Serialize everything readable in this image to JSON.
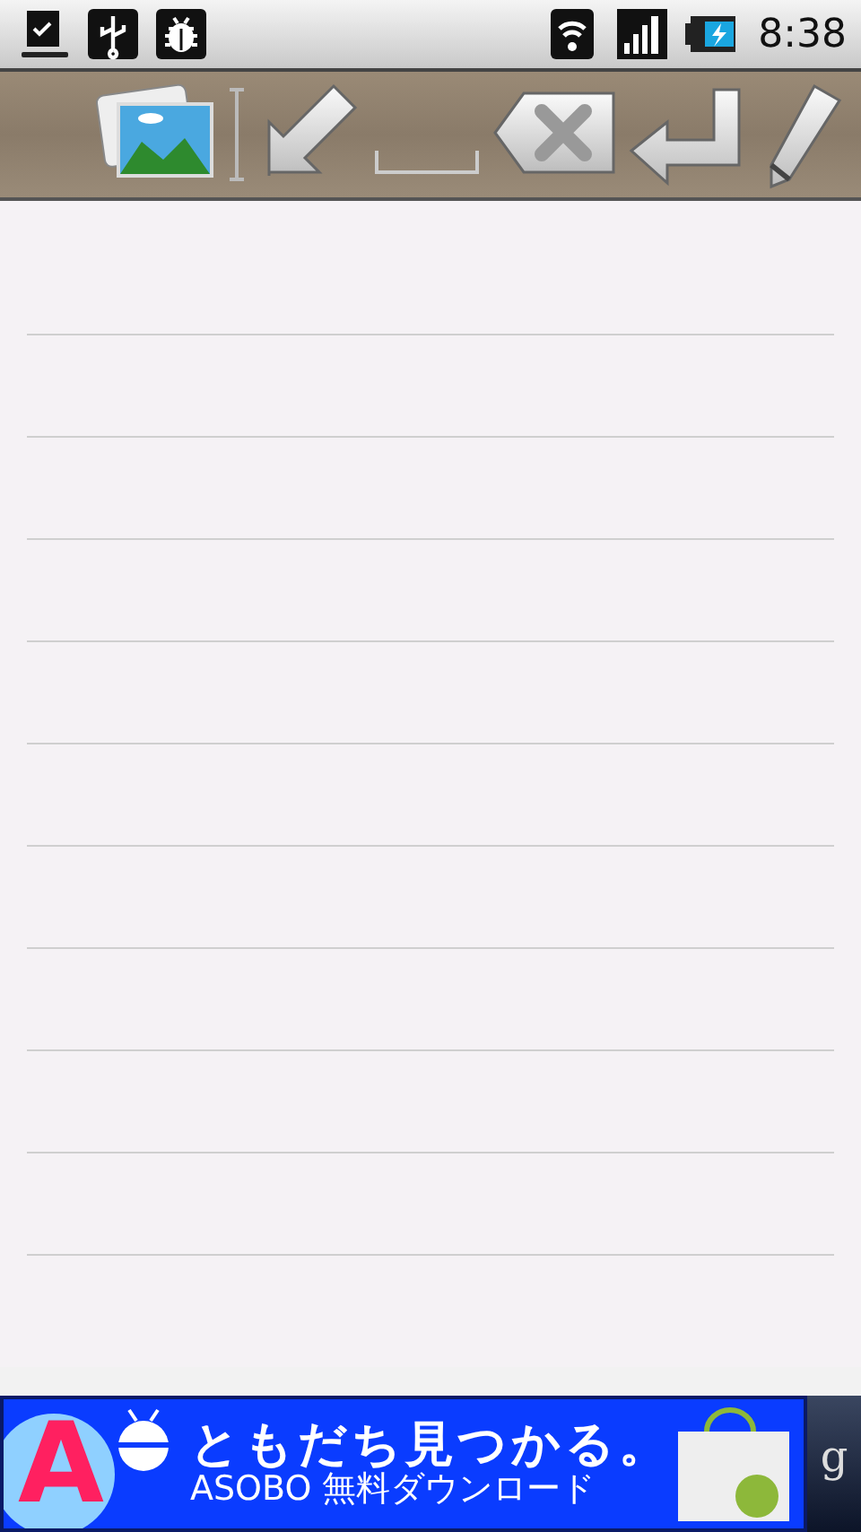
{
  "status_bar": {
    "left_icons": [
      {
        "kind": "download"
      },
      {
        "kind": "usb"
      },
      {
        "kind": "debug"
      }
    ],
    "right_icons": [
      {
        "kind": "wifi"
      },
      {
        "kind": "signal"
      },
      {
        "kind": "battery"
      }
    ],
    "time": "8:38"
  },
  "toolbar": [
    {
      "kind": "image"
    },
    {
      "kind": "cursor"
    },
    {
      "kind": "arrow"
    },
    {
      "kind": "space"
    },
    {
      "kind": "delete"
    },
    {
      "kind": "enter"
    },
    {
      "kind": "pencil"
    }
  ],
  "ad": {
    "logo": "A",
    "headline": "ともだち見つかる。",
    "subline": "ASOBO 無料ダウンロード",
    "side": "g"
  }
}
